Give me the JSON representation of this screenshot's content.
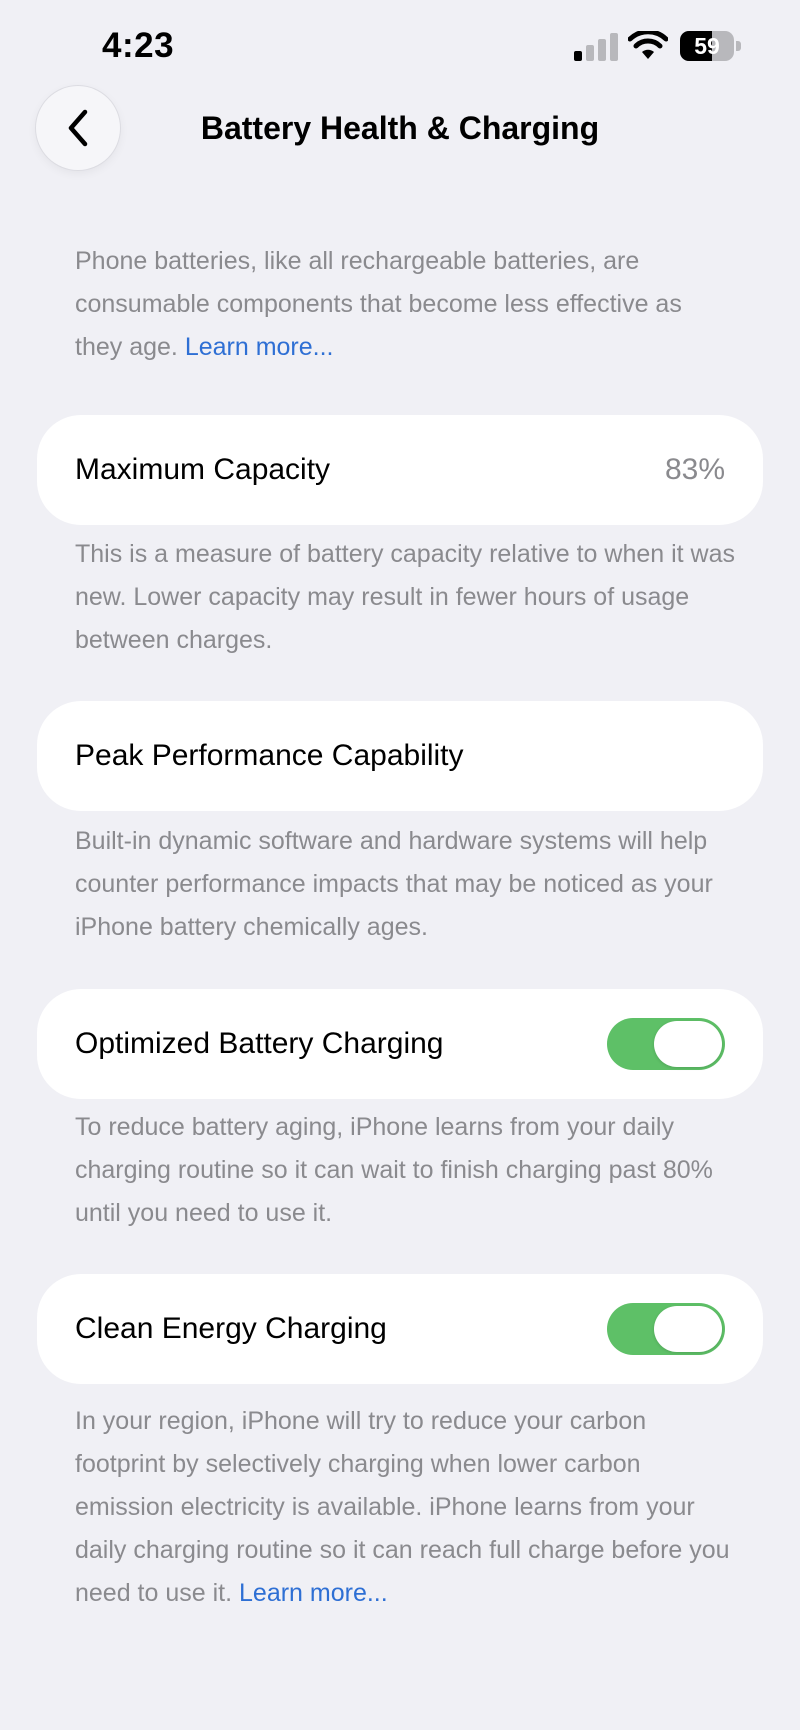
{
  "status_bar": {
    "time": "4:23",
    "battery_level_text": "59",
    "battery_level_fraction": 0.59,
    "icons": [
      "signal-icon",
      "wifi-icon",
      "battery-icon"
    ]
  },
  "nav": {
    "title": "Battery Health & Charging",
    "back_icon": "chevron-left-icon"
  },
  "intro": {
    "text": "Phone batteries, like all rechargeable batteries, are consumable components that become less effective as they age.",
    "link": "Learn more..."
  },
  "maximum_capacity": {
    "label": "Maximum Capacity",
    "value": "83%",
    "description": "This is a measure of battery capacity relative to when it was new. Lower capacity may result in fewer hours of usage between charges."
  },
  "peak_performance": {
    "label": "Peak Performance Capability",
    "description": "Built-in dynamic software and hardware systems will help counter performance impacts that may be noticed as your iPhone battery chemically ages."
  },
  "optimized_charging": {
    "label": "Optimized Battery Charging",
    "enabled": true,
    "description": "To reduce battery aging, iPhone learns from your daily charging routine so it can wait to finish charging past 80% until you need to use it."
  },
  "clean_energy_charging": {
    "label": "Clean Energy Charging",
    "enabled": true,
    "description": "In your region, iPhone will try to reduce your carbon footprint by selectively charging when lower carbon emission electricity is available. iPhone learns from your daily charging routine so it can reach full charge before you need to use it.",
    "link": "Learn more..."
  },
  "colors": {
    "background": "#f0f0f5",
    "card": "#ffffff",
    "secondary_text": "#8a8a8e",
    "link": "#2e6fd4",
    "toggle_on": "#5ec067"
  }
}
